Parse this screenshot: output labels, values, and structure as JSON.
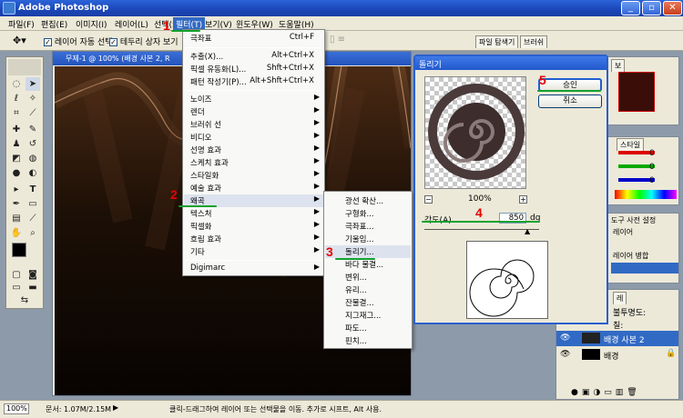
{
  "app": {
    "title": "Adobe Photoshop"
  },
  "menubar": [
    "파일(F)",
    "편집(E)",
    "이미지(I)",
    "레이어(L)",
    "선택(S)",
    "필터(T)",
    "보기(V)",
    "윈도우(W)",
    "도움말(H)"
  ],
  "options": {
    "auto_select": "레이어 자동 선택",
    "bbox": "테두리 상자 보기"
  },
  "panel_tabs": [
    "파일 탐색기",
    "브러쉬"
  ],
  "document": {
    "title": "무제-1 @ 100% (배경 사본 2, R"
  },
  "filter_menu": {
    "items": [
      {
        "label": "극좌표",
        "shortcut": "Ctrl+F"
      },
      {
        "label": "추출(X)...",
        "shortcut": "Alt+Ctrl+X"
      },
      {
        "label": "픽셀 유동화(L)...",
        "shortcut": "Shft+Ctrl+X"
      },
      {
        "label": "패턴 작성기(P)...",
        "shortcut": "Alt+Shft+Ctrl+X"
      },
      {
        "label": "노이즈"
      },
      {
        "label": "렌더"
      },
      {
        "label": "브러쉬 선"
      },
      {
        "label": "비디오"
      },
      {
        "label": "선명 효과"
      },
      {
        "label": "스케치 효과"
      },
      {
        "label": "스타일화"
      },
      {
        "label": "예술 효과"
      },
      {
        "label": "왜곡"
      },
      {
        "label": "텍스처"
      },
      {
        "label": "픽셀화"
      },
      {
        "label": "흐림 효과"
      },
      {
        "label": "기타"
      },
      {
        "label": "Digimarc"
      }
    ]
  },
  "distort_menu": [
    "광선 확산...",
    "구형화...",
    "극좌표...",
    "기울임...",
    "돌리기...",
    "바다 물결...",
    "변위...",
    "유리...",
    "잔물결...",
    "지그재그...",
    "파도...",
    "핀치..."
  ],
  "twirl_dialog": {
    "title": "돌리기",
    "ok": "승인",
    "cancel": "취소",
    "zoom": "100%",
    "angle_label": "각도(A)",
    "angle_value": "850",
    "angle_unit": "dg",
    "minus": "−",
    "plus": "+"
  },
  "annotations": [
    "1",
    "2",
    "3",
    "4",
    "5"
  ],
  "right_panels": {
    "tab1": "보",
    "tab2": "스타일",
    "color_values": [
      "0",
      "0",
      "0"
    ],
    "history_title": "도구 사전 설정",
    "history_items": [
      "레이어",
      "레이어 병합"
    ],
    "layers_tab": "레",
    "opacity_label": "불투명도:",
    "fill_label": "칠:",
    "layers": [
      {
        "name": "배경 사본 2"
      },
      {
        "name": "배경"
      }
    ]
  },
  "statusbar": {
    "zoom": "100%",
    "doc": "문서: 1.07M/2.15M",
    "hint": "클릭-드래그하여 레이어 또는 선택물을 이동. 추가로 시프트, Alt 사용."
  }
}
